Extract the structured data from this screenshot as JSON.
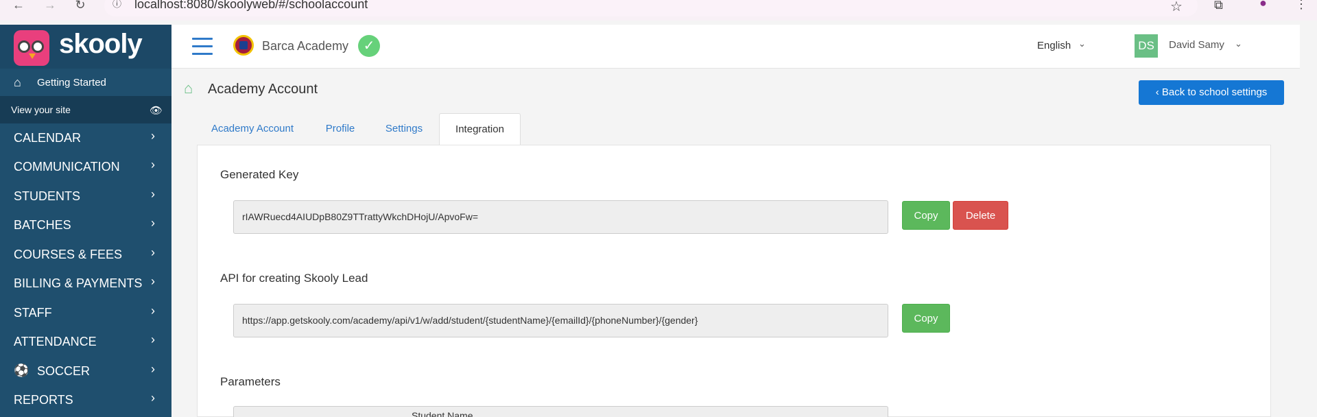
{
  "browser": {
    "url": "localhost:8080/skoolyweb/#/schoolaccount",
    "icons": {
      "back": "arrow-left",
      "forward": "arrow-right",
      "reload": "reload",
      "info": "info",
      "star": "star",
      "extensions": "puzzle",
      "profile": "person",
      "menu": "kebab"
    }
  },
  "sidebar": {
    "logo_text": "skooly",
    "getting_started": "Getting Started",
    "view_site": "View your site",
    "items": [
      {
        "label": "CALENDAR"
      },
      {
        "label": "COMMUNICATION"
      },
      {
        "label": "STUDENTS"
      },
      {
        "label": "BATCHES"
      },
      {
        "label": "COURSES & FEES"
      },
      {
        "label": "BILLING & PAYMENTS"
      },
      {
        "label": "STAFF"
      },
      {
        "label": "ATTENDANCE"
      },
      {
        "label": "SOCCER"
      },
      {
        "label": "REPORTS"
      }
    ]
  },
  "header": {
    "academy_name": "Barca Academy",
    "language": "English",
    "avatar_initials": "DS",
    "user_name": "David Samy"
  },
  "page": {
    "title": "Academy Account",
    "back_button": "Back to school settings",
    "tabs": [
      {
        "label": "Academy Account",
        "active": false
      },
      {
        "label": "Profile",
        "active": false
      },
      {
        "label": "Settings",
        "active": false
      },
      {
        "label": "Integration",
        "active": true
      }
    ]
  },
  "integration": {
    "generated_key_title": "Generated Key",
    "generated_key_value": "rIAWRuecd4AIUDpB80Z9TTrattyWkchDHojU/ApvoFw=",
    "copy_label": "Copy",
    "delete_label": "Delete",
    "api_title": "API for creating Skooly Lead",
    "api_value": "https://app.getskooly.com/academy/api/v1/w/add/student/{studentName}/{emailId}/{phoneNumber}/{gender}",
    "parameters_title": "Parameters",
    "param_header": "Student Name"
  },
  "colors": {
    "sidebar": "#1f4f6e",
    "primary": "#1577d4",
    "success": "#5cb85c",
    "danger": "#d9534f",
    "link": "#2f7ac9"
  }
}
